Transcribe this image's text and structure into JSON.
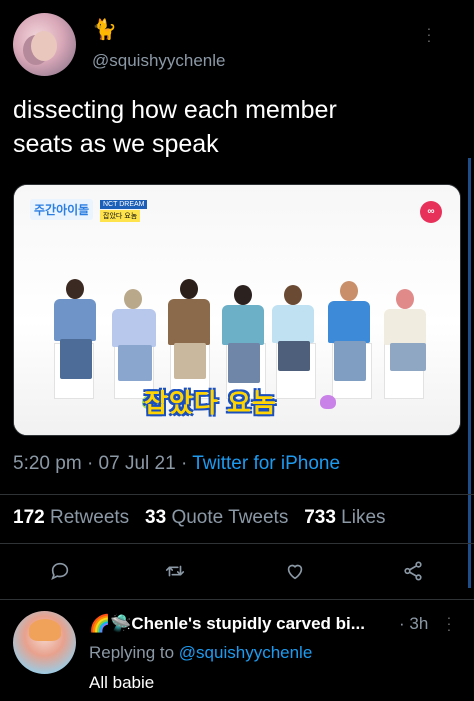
{
  "tweet": {
    "display_name_emoji": "🐈",
    "handle": "@squishyychenle",
    "text": "dissecting how each member\nseats as we speak",
    "media": {
      "show_logo": "주간아이돌",
      "tag_group": "NCT DREAM",
      "tag_episode": "잡았다 요놈",
      "channel_logo": "∞",
      "caption": "잡았다 요놈"
    },
    "time": "5:20 pm",
    "date": "07 Jul 21",
    "source": "Twitter for iPhone",
    "retweets_count": "172",
    "retweets_label": "Retweets",
    "quote_count": "33",
    "quote_label": "Quote Tweets",
    "likes_count": "733",
    "likes_label": "Likes"
  },
  "reply": {
    "display_name": "🌈🛸Chenle's stupidly carved bi...",
    "time": "· 3h",
    "replying_prefix": "Replying to",
    "replying_handle": "@squishyychenle",
    "text": "All babie"
  },
  "colors": {
    "background": "#000000",
    "secondary_text": "#8b98a5",
    "link": "#1d9bf0",
    "divider": "#2f3336"
  },
  "icons": [
    "more-vertical-icon",
    "reply-icon",
    "retweet-icon",
    "like-icon",
    "share-icon"
  ]
}
